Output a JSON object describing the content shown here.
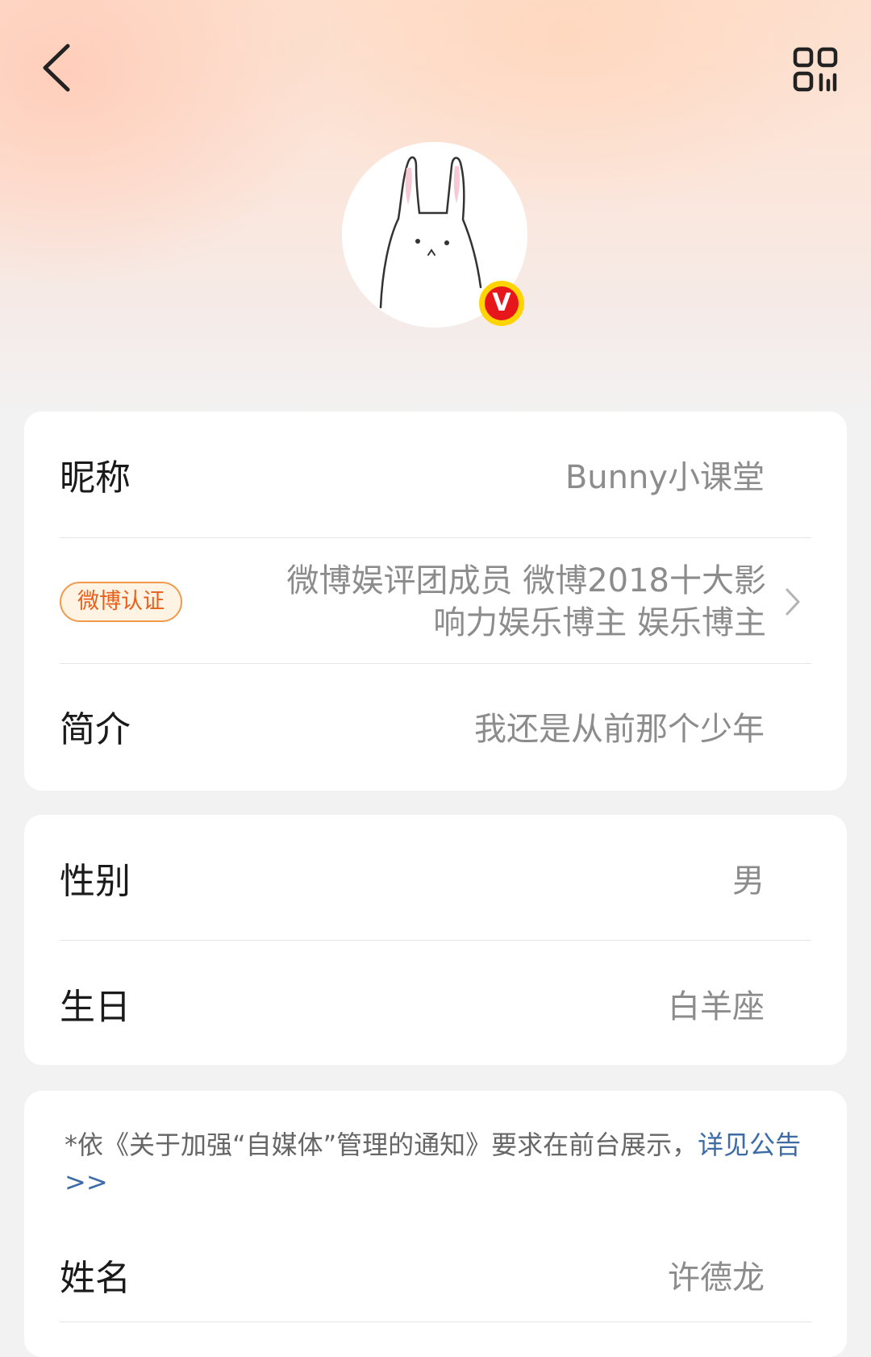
{
  "header": {
    "back_icon": "chevron-left-icon",
    "qr_icon": "qr-code-icon"
  },
  "profile": {
    "avatar_desc": "rabbit illustration",
    "verified_badge": "V",
    "badge_color": "#e6161b",
    "badge_ring": "#ffd400"
  },
  "basic_card": {
    "nickname_label": "昵称",
    "nickname_value": "Bunny小课堂",
    "verify_tag": "微博认证",
    "verify_line1": "微博娱评团成员 微博2018十大影",
    "verify_line2": "响力娱乐博主 娱乐博主",
    "bio_label": "简介",
    "bio_value": "我还是从前那个少年"
  },
  "personal_card": {
    "gender_label": "性别",
    "gender_value": "男",
    "birthday_label": "生日",
    "birthday_value": "白羊座"
  },
  "disclosure_card": {
    "notice_text": "*依《关于加强“自媒体”管理的通知》要求在前台展示，",
    "notice_link": "详见公告>>",
    "name_label": "姓名",
    "name_value": "许德龙"
  },
  "colors": {
    "accent_link": "#3c6ba6",
    "tag_text": "#e85f1c",
    "tag_border": "#f29a4c"
  }
}
